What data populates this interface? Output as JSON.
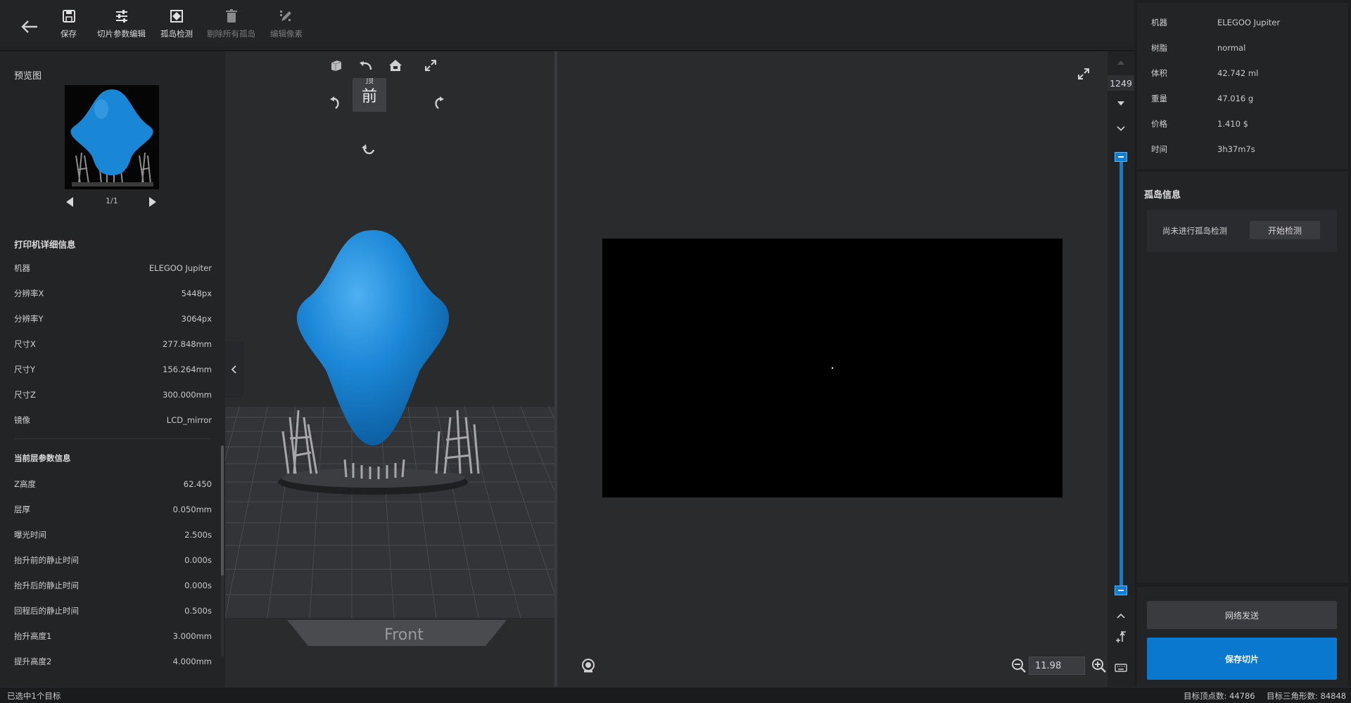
{
  "toolbar": {
    "save_label": "保存",
    "slice_params_label": "切片参数编辑",
    "island_detect_label": "孤岛检测",
    "delete_islands_label": "剔除所有孤岛",
    "edit_pixels_label": "编辑像素"
  },
  "left_panel": {
    "preview_title": "预览图",
    "preview_pager": "1/1",
    "printer_title": "打印机详细信息",
    "printer_rows": [
      {
        "k": "机器",
        "v": "ELEGOO Jupiter"
      },
      {
        "k": "分辨率X",
        "v": "5448px"
      },
      {
        "k": "分辨率Y",
        "v": "3064px"
      },
      {
        "k": "尺寸X",
        "v": "277.848mm"
      },
      {
        "k": "尺寸Y",
        "v": "156.264mm"
      },
      {
        "k": "尺寸Z",
        "v": "300.000mm"
      },
      {
        "k": "镜像",
        "v": "LCD_mirror"
      }
    ],
    "layer_title": "当前层参数信息",
    "layer_rows": [
      {
        "k": "Z高度",
        "v": "62.450"
      },
      {
        "k": "层厚",
        "v": "0.050mm"
      },
      {
        "k": "曝光时间",
        "v": "2.500s"
      },
      {
        "k": "抬升前的静止时间",
        "v": "0.000s"
      },
      {
        "k": "抬升后的静止时间",
        "v": "0.000s"
      },
      {
        "k": "回程后的静止时间",
        "v": "0.500s"
      },
      {
        "k": "抬升高度1",
        "v": "3.000mm"
      },
      {
        "k": "提升高度2",
        "v": "4.000mm"
      }
    ]
  },
  "view3d": {
    "cube_face_label": "前",
    "cube_top_partial": "顶",
    "floor_label": "Front"
  },
  "slice_view": {
    "zoom_value": "11.98"
  },
  "layer_slider": {
    "current_layer": "1249",
    "position_fraction": 1.0
  },
  "right_panel": {
    "model_rows": [
      {
        "k": "机器",
        "v": "ELEGOO Jupiter"
      },
      {
        "k": "树脂",
        "v": "normal"
      },
      {
        "k": "体积",
        "v": "42.742 ml"
      },
      {
        "k": "重量",
        "v": "47.016 g"
      },
      {
        "k": "价格",
        "v": "1.410 $"
      },
      {
        "k": "时间",
        "v": "3h37m7s"
      }
    ],
    "island_title": "孤岛信息",
    "island_status": "尚未进行孤岛检测",
    "start_detect_label": "开始检测",
    "network_send_label": "网络发送",
    "save_slice_label": "保存切片"
  },
  "statusbar": {
    "selected": "已选中1个目标",
    "vertices": "目标顶点数: 44786",
    "triangles": "目标三角形数: 84848"
  },
  "colors": {
    "accent": "#0b78d0",
    "model": "#1a86d6",
    "support": "#9a9a9a"
  }
}
